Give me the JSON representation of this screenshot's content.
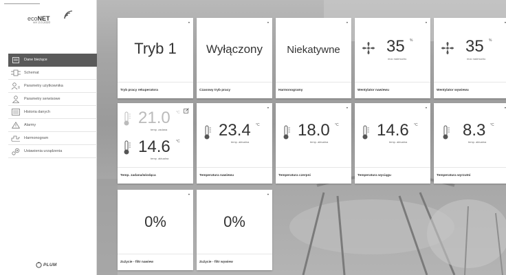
{
  "app": {
    "logo_prefix": "eco",
    "logo_bold": "NET",
    "version": "ver 2.0.2020",
    "brand": "PLUM"
  },
  "sidebar": {
    "items": [
      {
        "label": "Dane bieżące",
        "icon": "home-icon",
        "active": true
      },
      {
        "label": "Schemat",
        "icon": "schema-icon",
        "active": false
      },
      {
        "label": "Parametry użytkownika",
        "icon": "user-params-icon",
        "active": false
      },
      {
        "label": "Parametry serwisowe",
        "icon": "service-params-icon",
        "active": false
      },
      {
        "label": "Historia danych",
        "icon": "history-icon",
        "active": false
      },
      {
        "label": "Alarmy",
        "icon": "alarm-icon",
        "active": false
      },
      {
        "label": "Harmonogram",
        "icon": "schedule-icon",
        "active": false
      },
      {
        "label": "Ustawienia urządzenia",
        "icon": "device-settings-icon",
        "active": false
      }
    ]
  },
  "tiles": {
    "mode": {
      "value": "Tryb 1",
      "label": "Tryb pracy rekuperatora"
    },
    "temp_mode": {
      "value": "Wyłączony",
      "label": "Czasowy tryb pracy"
    },
    "schedules": {
      "value": "Niekatywne",
      "label": "Harmonogramy"
    },
    "fan_supply": {
      "value": "35",
      "unit": "%",
      "sub": "moc nadmuchu",
      "label": "Wentylator nawiewu"
    },
    "fan_exhaust": {
      "value": "35",
      "unit": "%",
      "sub": "moc nadmuchu",
      "label": "Wentylator wywiewu"
    },
    "temp_set": {
      "set_value": "21.0",
      "set_unit": "°C",
      "set_sub": "temp. zadana",
      "lead_value": "14.6",
      "lead_unit": "°C",
      "lead_sub": "temp. aktualna",
      "label": "Temp. zadana/wiodąca"
    },
    "temp_supply": {
      "value": "23.4",
      "unit": "°C",
      "sub": "temp. aktualna",
      "label": "Temperatura nawiewu"
    },
    "temp_intake": {
      "value": "18.0",
      "unit": "°C",
      "sub": "temp. aktualna",
      "label": "Temperatura czerpni"
    },
    "temp_extract": {
      "value": "14.6",
      "unit": "°C",
      "sub": "temp. aktualna",
      "label": "Temperatura wyciągu"
    },
    "temp_exhaust": {
      "value": "8.3",
      "unit": "°C",
      "sub": "temp. aktualna",
      "label": "Temperatura wyrzutni"
    },
    "filter_supply": {
      "value": "0%",
      "label": "Zużycie - filtr nawiew"
    },
    "filter_exhaust": {
      "value": "0%",
      "label": "Zużycie - filtr wywiew"
    }
  },
  "tile_menu_glyph": "•"
}
